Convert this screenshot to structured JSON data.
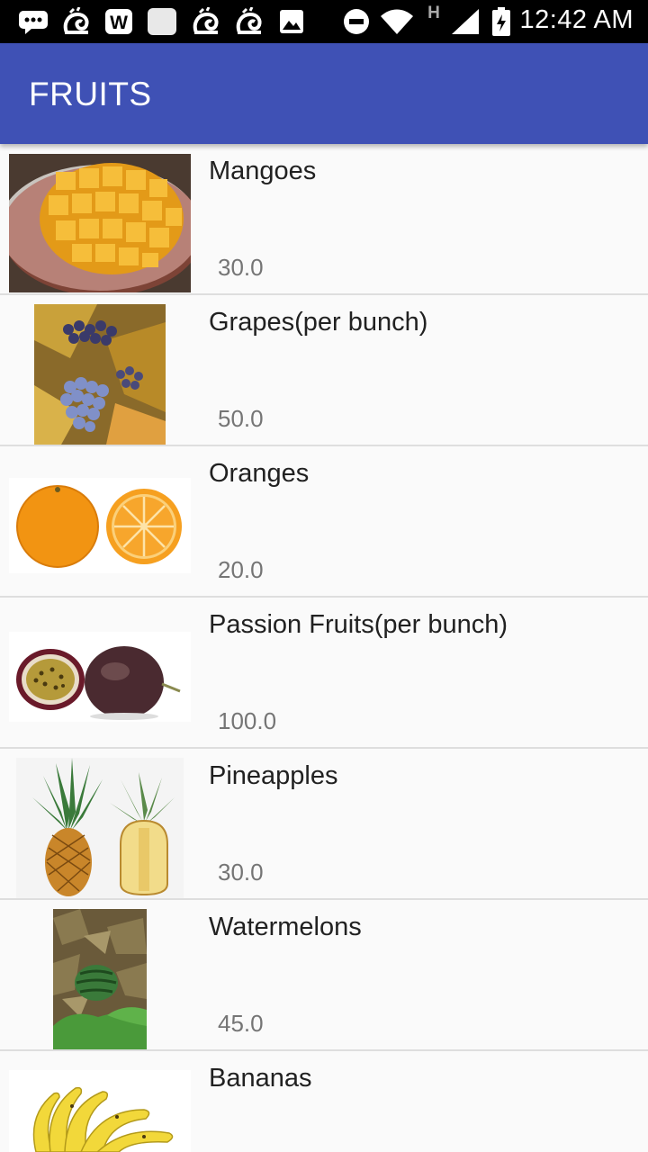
{
  "status_bar": {
    "time": "12:42 AM",
    "network_type": "H",
    "icons": [
      "message-icon",
      "uc-browser-icon",
      "word-icon",
      "blank-app-icon",
      "uc-browser-icon",
      "uc-browser-icon",
      "image-icon",
      "do-not-disturb-icon",
      "wifi-icon",
      "cell-signal-icon",
      "battery-icon"
    ]
  },
  "app_bar": {
    "title": "FRUITS"
  },
  "fruits": [
    {
      "name": "Mangoes",
      "price": "30.0",
      "image": "mango-photo"
    },
    {
      "name": "Grapes(per bunch)",
      "price": "50.0",
      "image": "grapes-photo"
    },
    {
      "name": "Oranges",
      "price": "20.0",
      "image": "oranges-photo"
    },
    {
      "name": "Passion Fruits(per bunch)",
      "price": "100.0",
      "image": "passion-fruits-photo"
    },
    {
      "name": "Pineapples",
      "price": "30.0",
      "image": "pineapples-photo"
    },
    {
      "name": "Watermelons",
      "price": "45.0",
      "image": "watermelon-photo"
    },
    {
      "name": "Bananas",
      "price": "",
      "image": "bananas-photo"
    }
  ],
  "colors": {
    "app_bar": "#3f51b5",
    "status_bar": "#000000",
    "background": "#fafafa"
  }
}
